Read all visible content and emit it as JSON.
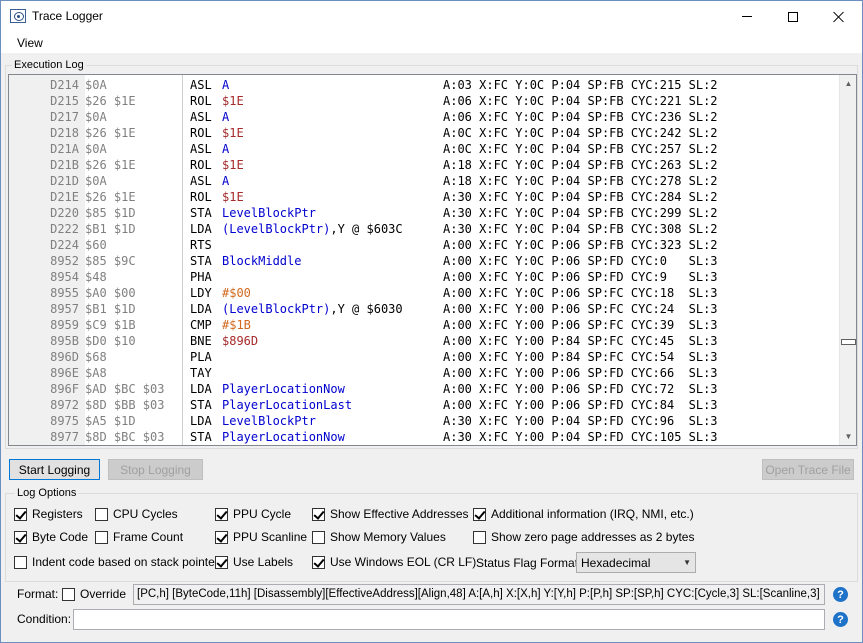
{
  "window": {
    "title": "Trace Logger"
  },
  "menu": {
    "view": "View"
  },
  "execution_log": {
    "group_label": "Execution Log",
    "rows": [
      {
        "pc": "D214",
        "bytes": "$0A",
        "op": "ASL",
        "arg": "A",
        "arg_kind": "reg",
        "suffix": "",
        "state": "A:03 X:FC Y:0C P:04 SP:FB CYC:215 SL:2"
      },
      {
        "pc": "D215",
        "bytes": "$26 $1E",
        "op": "ROL",
        "arg": "$1E",
        "arg_kind": "addr",
        "suffix": "",
        "state": "A:06 X:FC Y:0C P:04 SP:FB CYC:221 SL:2"
      },
      {
        "pc": "D217",
        "bytes": "$0A",
        "op": "ASL",
        "arg": "A",
        "arg_kind": "reg",
        "suffix": "",
        "state": "A:06 X:FC Y:0C P:04 SP:FB CYC:236 SL:2"
      },
      {
        "pc": "D218",
        "bytes": "$26 $1E",
        "op": "ROL",
        "arg": "$1E",
        "arg_kind": "addr",
        "suffix": "",
        "state": "A:0C X:FC Y:0C P:04 SP:FB CYC:242 SL:2"
      },
      {
        "pc": "D21A",
        "bytes": "$0A",
        "op": "ASL",
        "arg": "A",
        "arg_kind": "reg",
        "suffix": "",
        "state": "A:0C X:FC Y:0C P:04 SP:FB CYC:257 SL:2"
      },
      {
        "pc": "D21B",
        "bytes": "$26 $1E",
        "op": "ROL",
        "arg": "$1E",
        "arg_kind": "addr",
        "suffix": "",
        "state": "A:18 X:FC Y:0C P:04 SP:FB CYC:263 SL:2"
      },
      {
        "pc": "D21D",
        "bytes": "$0A",
        "op": "ASL",
        "arg": "A",
        "arg_kind": "reg",
        "suffix": "",
        "state": "A:18 X:FC Y:0C P:04 SP:FB CYC:278 SL:2"
      },
      {
        "pc": "D21E",
        "bytes": "$26 $1E",
        "op": "ROL",
        "arg": "$1E",
        "arg_kind": "addr",
        "suffix": "",
        "state": "A:30 X:FC Y:0C P:04 SP:FB CYC:284 SL:2"
      },
      {
        "pc": "D220",
        "bytes": "$85 $1D",
        "op": "STA",
        "arg": "LevelBlockPtr",
        "arg_kind": "label",
        "suffix": "",
        "state": "A:30 X:FC Y:0C P:04 SP:FB CYC:299 SL:2"
      },
      {
        "pc": "D222",
        "bytes": "$B1 $1D",
        "op": "LDA",
        "arg": "(LevelBlockPtr)",
        "arg_kind": "label",
        "suffix": ",Y @ $603C",
        "state": "A:30 X:FC Y:0C P:04 SP:FB CYC:308 SL:2"
      },
      {
        "pc": "D224",
        "bytes": "$60",
        "op": "RTS",
        "arg": "",
        "arg_kind": "none",
        "suffix": "",
        "state": "A:00 X:FC Y:0C P:06 SP:FB CYC:323 SL:2"
      },
      {
        "pc": "8952",
        "bytes": "$85 $9C",
        "op": "STA",
        "arg": "BlockMiddle",
        "arg_kind": "label",
        "suffix": "",
        "state": "A:00 X:FC Y:0C P:06 SP:FD CYC:0   SL:3"
      },
      {
        "pc": "8954",
        "bytes": "$48",
        "op": "PHA",
        "arg": "",
        "arg_kind": "none",
        "suffix": "",
        "state": "A:00 X:FC Y:0C P:06 SP:FD CYC:9   SL:3"
      },
      {
        "pc": "8955",
        "bytes": "$A0 $00",
        "op": "LDY",
        "arg": "#$00",
        "arg_kind": "imm",
        "suffix": "",
        "state": "A:00 X:FC Y:0C P:06 SP:FC CYC:18  SL:3"
      },
      {
        "pc": "8957",
        "bytes": "$B1 $1D",
        "op": "LDA",
        "arg": "(LevelBlockPtr)",
        "arg_kind": "label",
        "suffix": ",Y @ $6030",
        "state": "A:00 X:FC Y:00 P:06 SP:FC CYC:24  SL:3"
      },
      {
        "pc": "8959",
        "bytes": "$C9 $1B",
        "op": "CMP",
        "arg": "#$1B",
        "arg_kind": "imm",
        "suffix": "",
        "state": "A:00 X:FC Y:00 P:06 SP:FC CYC:39  SL:3"
      },
      {
        "pc": "895B",
        "bytes": "$D0 $10",
        "op": "BNE",
        "arg": "$896D",
        "arg_kind": "addr",
        "suffix": "",
        "state": "A:00 X:FC Y:00 P:84 SP:FC CYC:45  SL:3"
      },
      {
        "pc": "896D",
        "bytes": "$68",
        "op": "PLA",
        "arg": "",
        "arg_kind": "none",
        "suffix": "",
        "state": "A:00 X:FC Y:00 P:84 SP:FC CYC:54  SL:3"
      },
      {
        "pc": "896E",
        "bytes": "$A8",
        "op": "TAY",
        "arg": "",
        "arg_kind": "none",
        "suffix": "",
        "state": "A:00 X:FC Y:00 P:06 SP:FD CYC:66  SL:3"
      },
      {
        "pc": "896F",
        "bytes": "$AD $BC $03",
        "op": "LDA",
        "arg": "PlayerLocationNow",
        "arg_kind": "label",
        "suffix": "",
        "state": "A:00 X:FC Y:00 P:06 SP:FD CYC:72  SL:3"
      },
      {
        "pc": "8972",
        "bytes": "$8D $BB $03",
        "op": "STA",
        "arg": "PlayerLocationLast",
        "arg_kind": "label",
        "suffix": "",
        "state": "A:00 X:FC Y:00 P:06 SP:FD CYC:84  SL:3"
      },
      {
        "pc": "8975",
        "bytes": "$A5 $1D",
        "op": "LDA",
        "arg": "LevelBlockPtr",
        "arg_kind": "label",
        "suffix": "",
        "state": "A:30 X:FC Y:00 P:04 SP:FD CYC:96  SL:3"
      },
      {
        "pc": "8977",
        "bytes": "$8D $BC $03",
        "op": "STA",
        "arg": "PlayerLocationNow",
        "arg_kind": "label",
        "suffix": "",
        "state": "A:30 X:FC Y:00 P:04 SP:FD CYC:105 SL:3"
      }
    ]
  },
  "buttons": {
    "start_logging": "Start Logging",
    "stop_logging": "Stop Logging",
    "open_trace_file": "Open Trace File"
  },
  "log_options": {
    "group_label": "Log Options",
    "registers": {
      "label": "Registers",
      "checked": true
    },
    "byte_code": {
      "label": "Byte Code",
      "checked": true
    },
    "indent_code": {
      "label": "Indent code based on stack pointer",
      "checked": false
    },
    "cpu_cycles": {
      "label": "CPU Cycles",
      "checked": false
    },
    "frame_count": {
      "label": "Frame Count",
      "checked": false
    },
    "use_labels": {
      "label": "Use Labels",
      "checked": true
    },
    "ppu_cycle": {
      "label": "PPU Cycle",
      "checked": true
    },
    "ppu_scanline": {
      "label": "PPU Scanline",
      "checked": true
    },
    "use_windows_eol": {
      "label": "Use Windows EOL (CR LF)",
      "checked": true
    },
    "show_effective_addresses": {
      "label": "Show Effective Addresses",
      "checked": true
    },
    "show_memory_values": {
      "label": "Show Memory Values",
      "checked": false
    },
    "additional_information": {
      "label": "Additional information (IRQ, NMI, etc.)",
      "checked": true
    },
    "show_zero_page": {
      "label": "Show zero page addresses as 2 bytes",
      "checked": false
    },
    "status_flag_format_label": "Status Flag Format:",
    "status_flag_format_value": "Hexadecimal"
  },
  "format": {
    "label": "Format:",
    "override": {
      "label": "Override",
      "checked": false
    },
    "value": "[PC,h] [ByteCode,11h] [Disassembly][EffectiveAddress][Align,48] A:[A,h] X:[X,h] Y:[Y,h] P:[P,h] SP:[SP,h] CYC:[Cycle,3] SL:[Scanline,3]"
  },
  "condition": {
    "label": "Condition:",
    "value": ""
  },
  "help": {
    "symbol": "?"
  },
  "colors": {
    "label": "#0000d0",
    "address": "#a52a2a",
    "immediate": "#d2691e",
    "byte_code": "#808080"
  }
}
